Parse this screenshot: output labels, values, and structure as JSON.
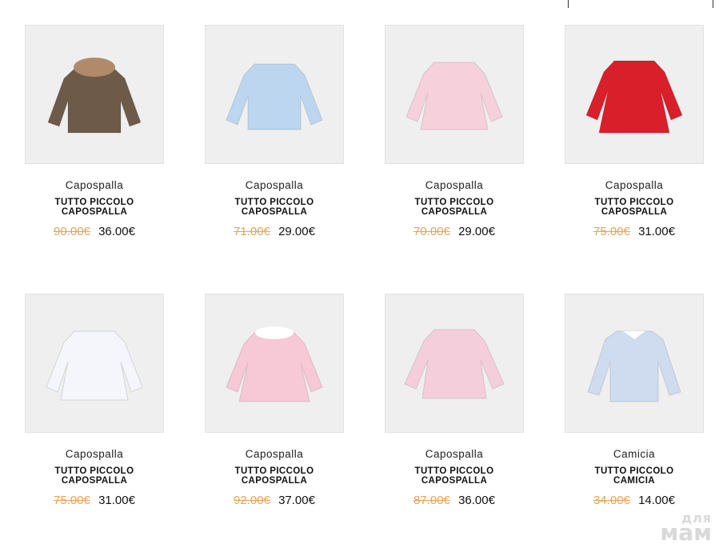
{
  "products": [
    {
      "category": "Capospalla",
      "name": "TUTTO PICCOLO CAPOSPALLA",
      "old_price": "90.00€",
      "price": "36.00€",
      "image": "brown-parka-fur-hood",
      "color": "#6e5a49"
    },
    {
      "category": "Capospalla",
      "name": "TUTTO PICCOLO CAPOSPALLA",
      "old_price": "71.00€",
      "price": "29.00€",
      "image": "light-blue-coat",
      "color": "#bcd6f0"
    },
    {
      "category": "Capospalla",
      "name": "TUTTO PICCOLO CAPOSPALLA",
      "old_price": "70.00€",
      "price": "29.00€",
      "image": "pink-coat-bows",
      "color": "#f6d1dc"
    },
    {
      "category": "Capospalla",
      "name": "TUTTO PICCOLO CAPOSPALLA",
      "old_price": "75.00€",
      "price": "31.00€",
      "image": "red-coat",
      "color": "#d81f2a"
    },
    {
      "category": "Capospalla",
      "name": "TUTTO PICCOLO CAPOSPALLA",
      "old_price": "75.00€",
      "price": "31.00€",
      "image": "white-coat-bows",
      "color": "#f4f6fb"
    },
    {
      "category": "Capospalla",
      "name": "TUTTO PICCOLO CAPOSPALLA",
      "old_price": "92.00€",
      "price": "37.00€",
      "image": "pink-coat-fur-collar",
      "color": "#f7c8d6"
    },
    {
      "category": "Capospalla",
      "name": "TUTTO PICCOLO CAPOSPALLA",
      "old_price": "87.00€",
      "price": "36.00€",
      "image": "pink-puffer-jacket",
      "color": "#f4cfdb"
    },
    {
      "category": "Camicia",
      "name": "TUTTO PICCOLO CAMICIA",
      "old_price": "34.00€",
      "price": "14.00€",
      "image": "light-blue-shirt",
      "color": "#cfdcef"
    }
  ],
  "watermark": {
    "line1": "для",
    "line2": "мам"
  }
}
